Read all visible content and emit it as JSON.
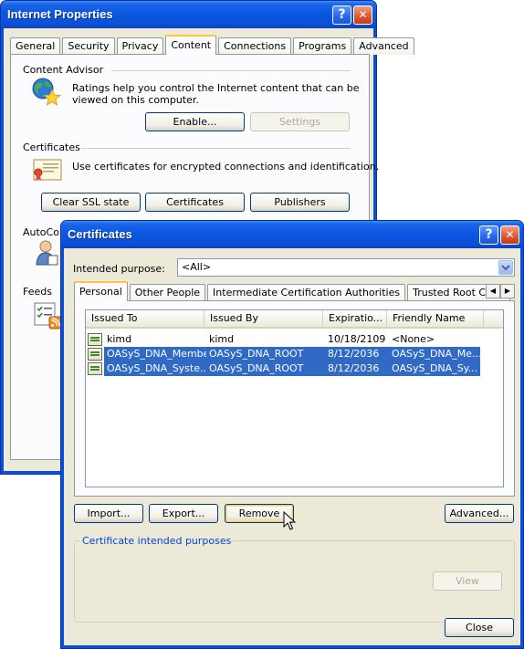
{
  "internet_properties": {
    "title": "Internet Properties",
    "help_glyph": "?",
    "close_glyph": "✕",
    "tabs": [
      "General",
      "Security",
      "Privacy",
      "Content",
      "Connections",
      "Programs",
      "Advanced"
    ],
    "content_advisor": {
      "heading": "Content Advisor",
      "description_line1": "Ratings help you control the Internet content that can be",
      "description_line2": "viewed on this computer.",
      "enable_label": "Enable...",
      "settings_label": "Settings"
    },
    "certificates": {
      "heading": "Certificates",
      "description": "Use certificates for encrypted connections and identification.",
      "clear_ssl_label": "Clear SSL state",
      "certificates_label": "Certificates",
      "publishers_label": "Publishers"
    },
    "autocomplete": {
      "heading": "AutoCom"
    },
    "feeds": {
      "heading": "Feeds"
    }
  },
  "certificates_dialog": {
    "title": "Certificates",
    "help_glyph": "?",
    "close_glyph": "✕",
    "intended_purpose_label": "Intended purpose:",
    "intended_purpose_value": "<All>",
    "tabs": [
      "Personal",
      "Other People",
      "Intermediate Certification Authorities",
      "Trusted Root Certification"
    ],
    "columns": [
      "Issued To",
      "Issued By",
      "Expiratio...",
      "Friendly Name"
    ],
    "rows": [
      {
        "issued_to": "kimd",
        "issued_by": "kimd",
        "expiration": "10/18/2109",
        "friendly_name": "<None>"
      },
      {
        "issued_to": "OASyS_DNA_Member",
        "issued_by": "OASyS_DNA_ROOT",
        "expiration": "8/12/2036",
        "friendly_name": "OASyS_DNA_Me..."
      },
      {
        "issued_to": "OASyS_DNA_Syste...",
        "issued_by": "OASyS_DNA_ROOT",
        "expiration": "8/12/2036",
        "friendly_name": "OASyS_DNA_Sy..."
      }
    ],
    "import_label": "Import...",
    "export_label": "Export...",
    "remove_label": "Remove",
    "advanced_label": "Advanced...",
    "intended_purposes_group": "Certificate intended purposes",
    "view_label": "View",
    "close_label": "Close"
  },
  "colors": {
    "titlebar": "#0a56df",
    "dialog_face": "#ece9d8",
    "selection": "#316ac5",
    "group_label": "#0046d5"
  }
}
